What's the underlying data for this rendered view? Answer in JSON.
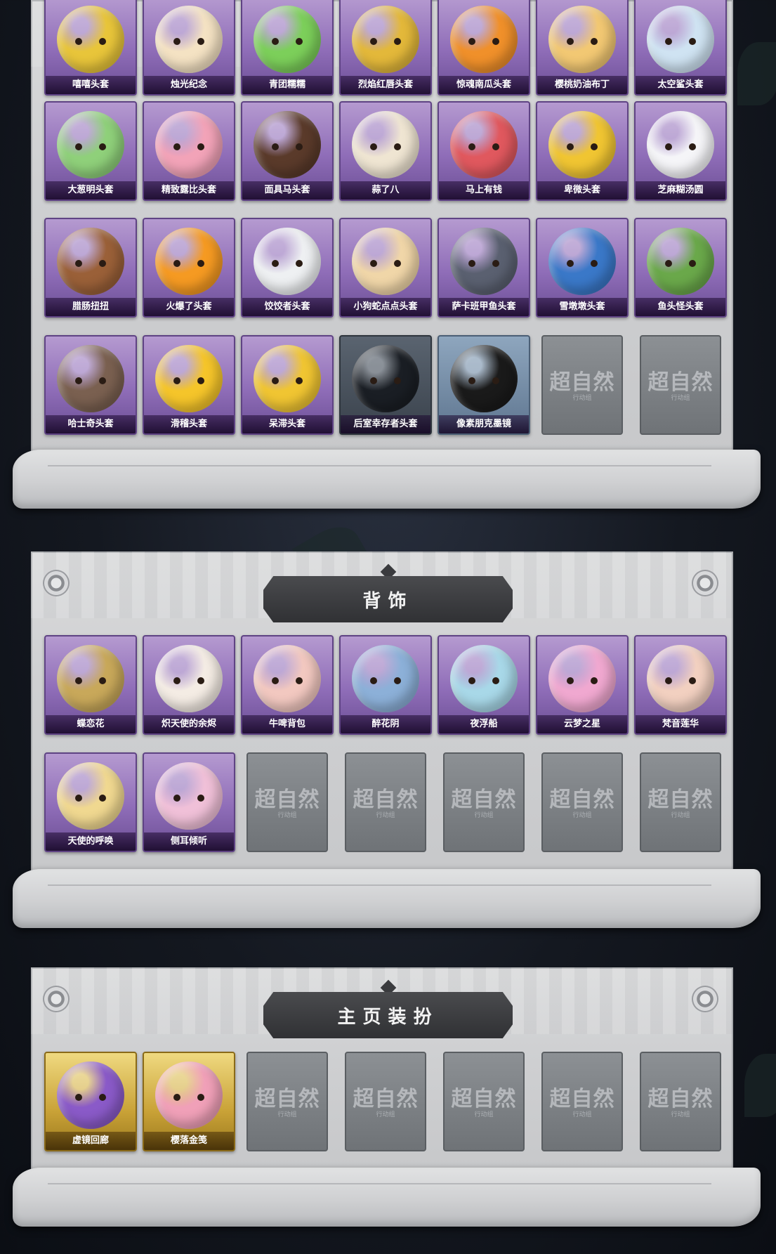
{
  "sections": [
    {
      "title": "",
      "items": [
        {
          "label": "嘻嘻头套",
          "style": "purple",
          "color": "#e8c53a"
        },
        {
          "label": "烛光纪念",
          "style": "purple",
          "color": "#f4e2c3"
        },
        {
          "label": "青团糯糯",
          "style": "purple",
          "color": "#7ccf5a"
        },
        {
          "label": "烈焰红唇头套",
          "style": "purple",
          "color": "#e3b83a"
        },
        {
          "label": "惊魂南瓜头套",
          "style": "purple",
          "color": "#f0902a"
        },
        {
          "label": "樱桃奶油布丁",
          "style": "purple",
          "color": "#f2c873"
        },
        {
          "label": "太空鲨头套",
          "style": "purple",
          "color": "#cfe3f2"
        },
        {
          "label": "大葱明头套",
          "style": "purple",
          "color": "#8fd07a"
        },
        {
          "label": "精致露比头套",
          "style": "purple",
          "color": "#f2a3b8"
        },
        {
          "label": "面具马头套",
          "style": "purple",
          "color": "#5a3a2a"
        },
        {
          "label": "蒜了八",
          "style": "purple",
          "color": "#efe5d2"
        },
        {
          "label": "马上有钱",
          "style": "purple",
          "color": "#e0585e"
        },
        {
          "label": "卑微头套",
          "style": "purple",
          "color": "#f0c532"
        },
        {
          "label": "芝麻糊汤圆",
          "style": "purple",
          "color": "#f5f5f8"
        },
        {
          "label": "腊肠扭扭",
          "style": "purple",
          "color": "#9a6038"
        },
        {
          "label": "火爆了头套",
          "style": "purple",
          "color": "#f59a22"
        },
        {
          "label": "饺饺者头套",
          "style": "purple",
          "color": "#eef0f2"
        },
        {
          "label": "小狗蛇点点头套",
          "style": "purple",
          "color": "#f0d6a8"
        },
        {
          "label": "萨卡班甲鱼头套",
          "style": "purple",
          "color": "#5a6070"
        },
        {
          "label": "雪墩墩头套",
          "style": "purple",
          "color": "#3a78c8"
        },
        {
          "label": "鱼头怪头套",
          "style": "purple",
          "color": "#6aa84a"
        },
        {
          "label": "哈士奇头套",
          "style": "purple",
          "color": "#7a6050"
        },
        {
          "label": "滑稽头套",
          "style": "purple",
          "color": "#f5c52a"
        },
        {
          "label": "呆滞头套",
          "style": "purple",
          "color": "#f0c532"
        },
        {
          "label": "后室幸存者头套",
          "style": "dark",
          "color": "#1a1e24"
        },
        {
          "label": "像素朋克墨镜",
          "style": "blue",
          "color": "#1a1a1a"
        },
        {
          "label": "",
          "style": "empty",
          "color": ""
        },
        {
          "label": "",
          "style": "empty",
          "color": ""
        }
      ]
    },
    {
      "title": "背饰",
      "items": [
        {
          "label": "蝶恋花",
          "style": "purple",
          "color": "#c8a85a"
        },
        {
          "label": "炽天使的余烬",
          "style": "purple",
          "color": "#f4ece4"
        },
        {
          "label": "牛啤背包",
          "style": "purple",
          "color": "#f2c8c0"
        },
        {
          "label": "醉花阴",
          "style": "purple",
          "color": "#8cb0d8"
        },
        {
          "label": "夜浮船",
          "style": "purple",
          "color": "#a8d8e8"
        },
        {
          "label": "云梦之星",
          "style": "purple",
          "color": "#f0a8d0"
        },
        {
          "label": "梵音莲华",
          "style": "purple",
          "color": "#f2d0c0"
        },
        {
          "label": "天使的呼唤",
          "style": "purple",
          "color": "#f0d890"
        },
        {
          "label": "侧耳倾听",
          "style": "purple",
          "color": "#f0c0d8"
        },
        {
          "label": "",
          "style": "empty",
          "color": ""
        },
        {
          "label": "",
          "style": "empty",
          "color": ""
        },
        {
          "label": "",
          "style": "empty",
          "color": ""
        },
        {
          "label": "",
          "style": "empty",
          "color": ""
        },
        {
          "label": "",
          "style": "empty",
          "color": ""
        }
      ]
    },
    {
      "title": "主页装扮",
      "items": [
        {
          "label": "虚镜回廊",
          "style": "gold",
          "color": "#8a5ac8"
        },
        {
          "label": "樱落金笺",
          "style": "gold",
          "color": "#f0a0b8"
        },
        {
          "label": "",
          "style": "empty",
          "color": ""
        },
        {
          "label": "",
          "style": "empty",
          "color": ""
        },
        {
          "label": "",
          "style": "empty",
          "color": ""
        },
        {
          "label": "",
          "style": "empty",
          "color": ""
        },
        {
          "label": "",
          "style": "empty",
          "color": ""
        }
      ]
    }
  ],
  "watermark": {
    "main": "超自然",
    "sub": "行动组"
  }
}
